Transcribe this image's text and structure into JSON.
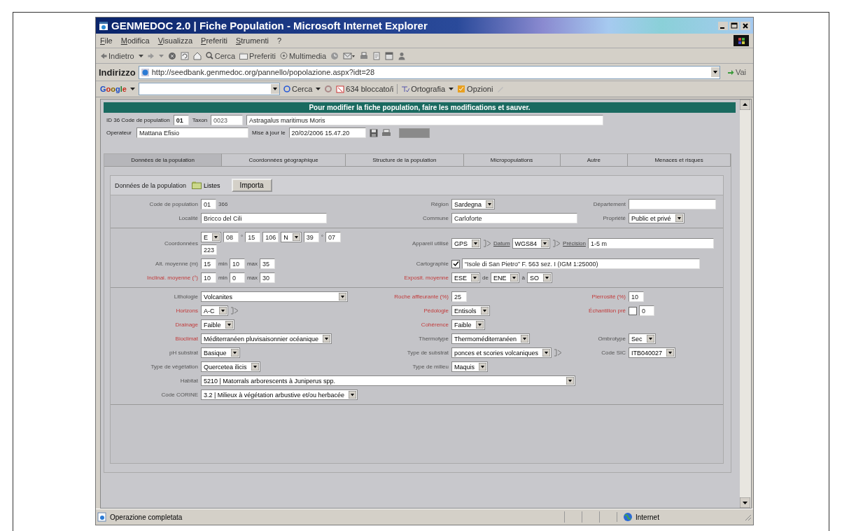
{
  "window": {
    "title": "GENMEDOC 2.0 | Fiche Population - Microsoft Internet Explorer"
  },
  "menu_bar": [
    "File",
    "Modifica",
    "Visualizza",
    "Preferiti",
    "Strumenti",
    "?"
  ],
  "toolbar": {
    "back": "Indietro",
    "search": "Cerca",
    "favorites": "Preferiti",
    "media": "Multimedia"
  },
  "address_bar": {
    "label": "Indirizzo",
    "url": "http://seedbank.genmedoc.org/pannello/popolazione.aspx?idt=28",
    "go": "Vai"
  },
  "google_bar": {
    "logo": "Google",
    "search": "Cerca",
    "blocked": "634 bloccato/i",
    "spelling": "Ortografia",
    "options": "Opzioni"
  },
  "page": {
    "banner": "Pour modifier la fiche population, faire les modifications et sauver.",
    "header": {
      "id_label": "ID 36 Code de population",
      "code": "01",
      "taxon_label": "Taxon",
      "taxon_code": "0023",
      "taxon_name": "Astragalus maritimus Moris",
      "operator_label": "Operateur",
      "operator": "Mattana Efisio",
      "updated_label": "Mise à jour le",
      "updated": "20/02/2006 15.47.20",
      "close_button": {
        "disabled": true
      }
    },
    "tabs": [
      {
        "label": "Données de la population",
        "selected": true
      },
      {
        "label": "Coordonnées géographique",
        "selected": false
      },
      {
        "label": "Structure de la population",
        "selected": false
      },
      {
        "label": "Micropopulations",
        "selected": false
      },
      {
        "label": "Autre",
        "selected": false
      },
      {
        "label": "Menaces et risques",
        "selected": false
      }
    ],
    "subbar": {
      "title": "Données de la population",
      "lists": "Listes",
      "import": "Importa"
    },
    "sections": [
      {
        "rows": [
          {
            "left": {
              "label": "Code de population",
              "required": false,
              "controls": [
                {
                  "kind": "number",
                  "value": "01"
                },
                {
                  "kind": "text",
                  "value": "366"
                }
              ]
            },
            "middle": {
              "label": "Région",
              "required": false,
              "controls": [
                {
                  "kind": "select",
                  "value": "Sardegna"
                }
              ]
            },
            "right": {
              "label": "Département",
              "required": false,
              "controls": [
                {
                  "kind": "input"
                }
              ]
            }
          },
          {
            "left": {
              "label": "Localité",
              "required": false,
              "controls": [
                {
                  "kind": "input",
                  "value": "Bricco del Cili"
                }
              ]
            },
            "middle": {
              "label": "Commune",
              "required": false,
              "controls": [
                {
                  "kind": "input",
                  "value": "Carloforte"
                }
              ]
            },
            "right": {
              "label": "Propriété",
              "required": false,
              "controls": [
                {
                  "kind": "select",
                  "value": "Public et privé"
                }
              ]
            }
          }
        ]
      },
      {
        "rows": [
          {
            "left": {
              "label": "Coordonnées",
              "required": false,
              "controls": [
                {
                  "kind": "select",
                  "value": "E"
                },
                {
                  "kind": "number",
                  "value": "08"
                },
                {
                  "kind": "text",
                  "value": "°"
                },
                {
                  "kind": "number",
                  "value": "15"
                },
                {
                  "kind": "number",
                  "value": "106"
                },
                {
                  "kind": "select",
                  "value": "N"
                },
                {
                  "kind": "number",
                  "value": "39"
                },
                {
                  "kind": "text",
                  "value": "°"
                },
                {
                  "kind": "number",
                  "value": "07"
                },
                {
                  "kind": "number",
                  "value": "223"
                }
              ]
            },
            "middle": {
              "label": "Appareil utilisé",
              "required": false,
              "controls": [
                {
                  "kind": "select",
                  "value": "GPS"
                },
                {
                  "kind": "icon"
                },
                {
                  "kind": "link",
                  "value": "Datum"
                },
                {
                  "kind": "select",
                  "value": "WGS84"
                },
                {
                  "kind": "icon"
                },
                {
                  "kind": "link",
                  "value": "Précision"
                },
                {
                  "kind": "input",
                  "value": "1-5 m"
                }
              ]
            }
          },
          {
            "left": {
              "label": "Alt. moyenne (m)",
              "required": false,
              "controls": [
                {
                  "kind": "number",
                  "value": "15"
                },
                {
                  "kind": "text",
                  "value": "min"
                },
                {
                  "kind": "number",
                  "value": "10"
                },
                {
                  "kind": "text",
                  "value": "max"
                },
                {
                  "kind": "number",
                  "value": "35"
                }
              ]
            },
            "middle": {
              "label": "Cartographie",
              "required": false,
              "controls": [
                {
                  "kind": "checkbox",
                  "checked": true
                },
                {
                  "kind": "wide-input",
                  "value": "“Isole di San Pietro” F. 563 sez. I (IGM 1:25000)"
                }
              ]
            }
          },
          {
            "left": {
              "label": "Inclinai. moyenne (°)",
              "required": true,
              "controls": [
                {
                  "kind": "number",
                  "value": "10"
                },
                {
                  "kind": "text",
                  "value": "min"
                },
                {
                  "kind": "number",
                  "value": "0"
                },
                {
                  "kind": "text",
                  "value": "max"
                },
                {
                  "kind": "number",
                  "value": "30"
                }
              ]
            },
            "middle": {
              "label": "Exposit. moyenne",
              "required": true,
              "controls": [
                {
                  "kind": "select",
                  "value": "ESE"
                },
                {
                  "kind": "text",
                  "value": "de"
                },
                {
                  "kind": "select",
                  "value": "ENE"
                },
                {
                  "kind": "text",
                  "value": "à"
                },
                {
                  "kind": "select",
                  "value": "SO"
                }
              ]
            }
          }
        ]
      },
      {
        "rows": [
          {
            "left": {
              "label": "Lithologie",
              "required": false,
              "controls": [
                {
                  "kind": "wide-select",
                  "value": "Volcanites"
                }
              ]
            },
            "middle": {
              "label": "Roche affleurante (%)",
              "required": true,
              "controls": [
                {
                  "kind": "number",
                  "value": "25"
                }
              ]
            },
            "right": {
              "label": "Pierrosité (%)",
              "required": true,
              "controls": [
                {
                  "kind": "number",
                  "value": "10"
                }
              ]
            }
          },
          {
            "left": {
              "label": "Horizons",
              "required": true,
              "controls": [
                {
                  "kind": "select",
                  "value": "A-C"
                },
                {
                  "kind": "icon"
                }
              ]
            },
            "middle": {
              "label": "Pédologie",
              "required": true,
              "controls": [
                {
                  "kind": "select",
                  "value": "Entisols"
                }
              ]
            },
            "right": {
              "label": "Échantillon pré",
              "required": true,
              "controls": [
                {
                  "kind": "checkbox",
                  "checked": false
                },
                {
                  "kind": "number",
                  "value": "0"
                }
              ]
            }
          },
          {
            "left": {
              "label": "Drainage",
              "required": true,
              "controls": [
                {
                  "kind": "select",
                  "value": "Faible"
                }
              ]
            },
            "middle": {
              "label": "Cohérence",
              "required": true,
              "controls": [
                {
                  "kind": "select",
                  "value": "Faible"
                }
              ]
            }
          },
          {
            "left": {
              "label": "Bioclimat",
              "required": true,
              "controls": [
                {
                  "kind": "select",
                  "value": "Méditerranéen pluvisaisonnier océanique"
                }
              ]
            },
            "middle": {
              "label": "Thermotype",
              "required": false,
              "controls": [
                {
                  "kind": "select",
                  "value": "Thermoméditerranéen"
                }
              ]
            },
            "right": {
              "label": "Ombrotype",
              "required": false,
              "controls": [
                {
                  "kind": "select",
                  "value": "Sec"
                }
              ]
            }
          },
          {
            "left": {
              "label": "pH substrat",
              "required": false,
              "controls": [
                {
                  "kind": "select",
                  "value": "Basique"
                }
              ]
            },
            "middle": {
              "label": "Type de substrat",
              "required": false,
              "controls": [
                {
                  "kind": "select",
                  "value": "ponces et scories volcaniques"
                },
                {
                  "kind": "icon"
                }
              ]
            },
            "right": {
              "label": "Code SIC",
              "required": false,
              "controls": [
                {
                  "kind": "select",
                  "value": "ITB040027"
                }
              ]
            }
          },
          {
            "left": {
              "label": "Type de végétation",
              "required": false,
              "controls": [
                {
                  "kind": "select",
                  "value": "Quercetea ilicis"
                }
              ]
            },
            "middle": {
              "label": "Type de milieu",
              "required": false,
              "controls": [
                {
                  "kind": "select",
                  "value": "Maquis"
                }
              ]
            }
          },
          {
            "left": {
              "label": "Habitat",
              "required": false,
              "controls": [
                {
                  "kind": "wide-select",
                  "value": "5210 | Matorrals arborescents à Juniperus spp."
                }
              ]
            }
          },
          {
            "left": {
              "label": "Code CORINE",
              "required": false,
              "controls": [
                {
                  "kind": "select",
                  "value": "3.2 | Milieux à végétation arbustive et/ou herbacée"
                }
              ]
            }
          }
        ]
      }
    ]
  },
  "status_bar": {
    "message": "Operazione completata",
    "zone": "Internet"
  }
}
